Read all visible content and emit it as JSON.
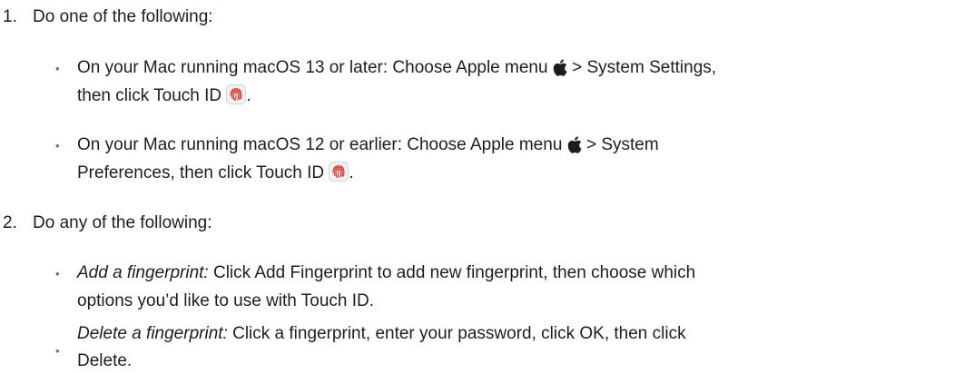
{
  "steps": [
    {
      "number": "1.",
      "text": "Do one of the following:",
      "bullets": [
        {
          "line1_before_icon": "On your Mac running macOS 13 or later: Choose Apple menu ",
          "line1_after_icon": " > System Settings,",
          "line2_before_icon": "then click Touch ID ",
          "line2_after_icon": ".",
          "apple_icon": "apple-logo-icon",
          "touchid_icon": "fingerprint-icon"
        },
        {
          "line1_before_icon": "On your Mac running macOS 12 or earlier: Choose Apple menu ",
          "line1_after_icon": " > System",
          "line2_before_icon": "Preferences, then click Touch ID ",
          "line2_after_icon": ".",
          "apple_icon": "apple-logo-icon",
          "touchid_icon": "fingerprint-icon"
        }
      ]
    },
    {
      "number": "2.",
      "text": "Do any of the following:",
      "bullets": [
        {
          "term": "Add a fingerprint:",
          "line1_rest": " Click Add Fingerprint to add new fingerprint, then choose which",
          "line2": "options you’d like to use with Touch ID."
        },
        {
          "term": "Delete a fingerprint:",
          "line1_rest": " Click a fingerprint, enter your password, click OK, then click",
          "line2": "Delete."
        }
      ]
    }
  ],
  "bullet_char": "•",
  "colors": {
    "text": "#1d1d1f",
    "bullet": "#6e6e73",
    "touchid_red": "#e0443e"
  }
}
